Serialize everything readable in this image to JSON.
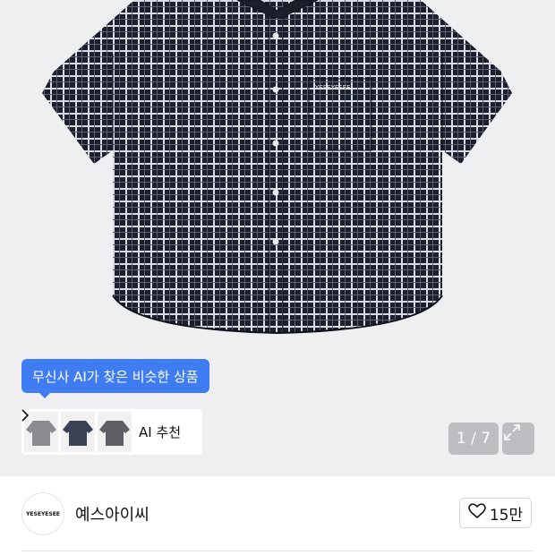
{
  "hero": {
    "ai_tooltip": "무신사 AI가 찾은 비슷한 상품",
    "ai_recommend_label": "AI 추천",
    "image_counter": "1 / 7",
    "logo_text": "YESEYESEE"
  },
  "brand": {
    "name": "예스아이씨",
    "logo_text": "YESEYESEE",
    "like_count": "15만"
  },
  "colors": {
    "accent": "#3f7cf2",
    "shirt": "#1b1e2b",
    "hero_bg": "#efeff1"
  }
}
